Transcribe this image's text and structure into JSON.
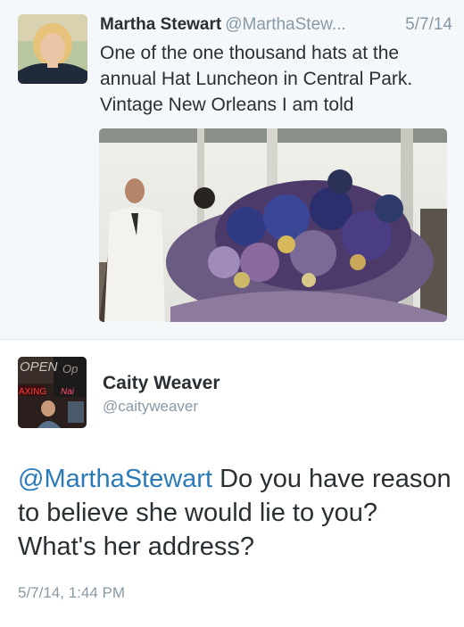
{
  "tweet1": {
    "name": "Martha Stewart",
    "handle": "@MarthaStew...",
    "date": "5/7/14",
    "text": "One of the one thousand hats at the annual Hat Luncheon in Central Park. Vintage New Orleans I am told"
  },
  "tweet2": {
    "name": "Caity Weaver",
    "handle": "@caityweaver",
    "mention": "@MarthaStewart",
    "text": " Do you have reason to believe she would lie to you? What's her address?",
    "timestamp": "5/7/14, 1:44 PM",
    "avatar_sign_text": [
      "OPEN",
      "Op",
      "AXING",
      "Nai"
    ]
  },
  "colors": {
    "top_bg": "#f5f8fa",
    "text": "#292f33",
    "muted": "#8899a6",
    "link": "#2b7bb9",
    "divider": "#e1e8ed"
  }
}
